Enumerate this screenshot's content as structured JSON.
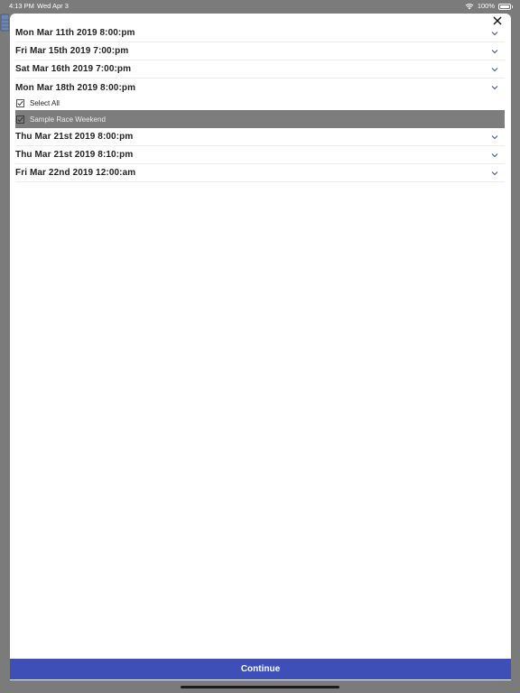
{
  "status_bar": {
    "time": "4:13 PM",
    "date": "Wed Apr 3",
    "battery": "100%"
  },
  "modal": {
    "dates": [
      {
        "label": "Mon Mar 11th 2019 8:00:pm"
      },
      {
        "label": "Fri Mar 15th 2019 7:00:pm"
      },
      {
        "label": "Sat Mar 16th 2019 7:00:pm"
      },
      {
        "label": "Mon Mar 18th 2019 8:00:pm"
      }
    ],
    "expanded": {
      "select_all_label": "Select All",
      "items": [
        {
          "label": "Sample Race Weekend",
          "checked": true
        }
      ]
    },
    "dates_after": [
      {
        "label": "Thu Mar 21st 2019 8:00:pm"
      },
      {
        "label": "Thu Mar 21st 2019 8:10:pm"
      },
      {
        "label": "Fri Mar 22nd 2019 12:00:am"
      }
    ]
  },
  "footer": {
    "continue_label": "Continue"
  },
  "colors": {
    "accent": "#3f4fb8",
    "chevron": "#3f4fb8",
    "highlight": "#7d7d7d",
    "overlay": "#7b7b7b"
  },
  "icons": {
    "close": "close-icon",
    "chevron": "chevron-down-icon",
    "check": "checkmark-icon",
    "wifi": "wifi-icon",
    "battery": "battery-icon"
  }
}
